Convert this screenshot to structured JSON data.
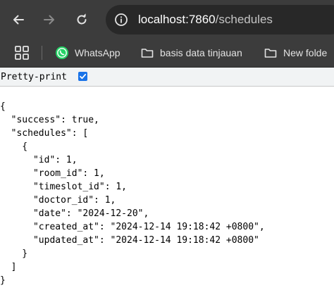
{
  "browser": {
    "address_bar": {
      "host": "localhost:7860",
      "path": "/schedules"
    },
    "bookmarks": [
      {
        "label": "WhatsApp",
        "icon": "whatsapp-icon"
      },
      {
        "label": "basis data tinjauan",
        "icon": "folder-icon"
      },
      {
        "label": "New folde",
        "icon": "folder-icon"
      }
    ]
  },
  "viewer": {
    "pretty_print_label": "Pretty-print",
    "pretty_print_checked": true
  },
  "json_lines": [
    "{",
    "  \"success\": true,",
    "  \"schedules\": [",
    "    {",
    "      \"id\": 1,",
    "      \"room_id\": 1,",
    "      \"timeslot_id\": 1,",
    "      \"doctor_id\": 1,",
    "      \"date\": \"2024-12-20\",",
    "      \"created_at\": \"2024-12-14 19:18:42 +0800\",",
    "      \"updated_at\": \"2024-12-14 19:18:42 +0800\"",
    "    }",
    "  ]",
    "}"
  ]
}
